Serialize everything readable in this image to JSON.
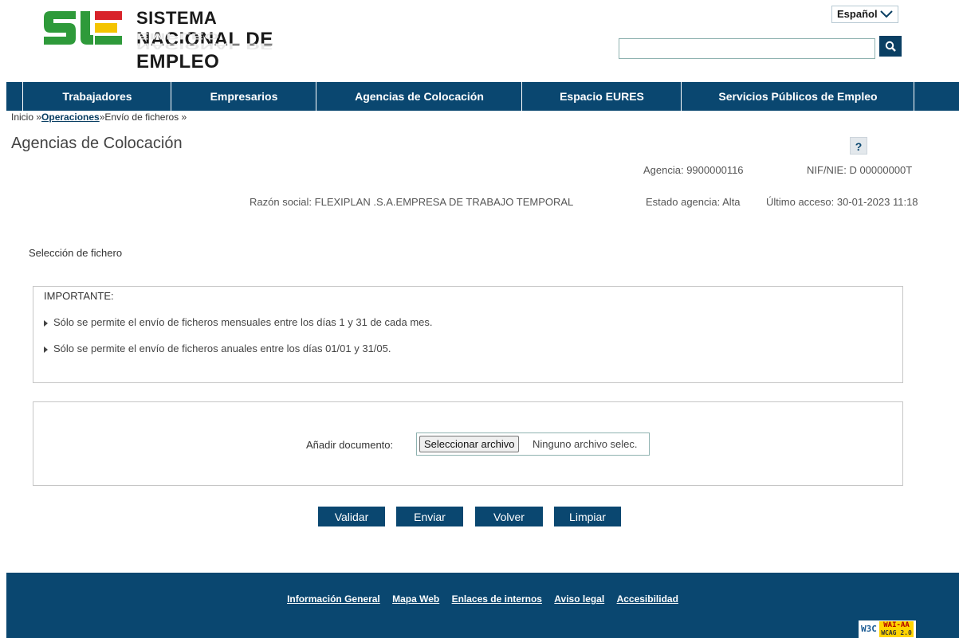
{
  "header": {
    "logo_line1": "SISTEMA",
    "logo_line2": "NACIONAL DE EMPLEO",
    "language": "Español",
    "search_placeholder": ""
  },
  "nav": {
    "items": [
      {
        "label": "Trabajadores"
      },
      {
        "label": "Empresarios"
      },
      {
        "label": "Agencias de Colocación"
      },
      {
        "label": "Espacio EURES"
      },
      {
        "label": "Servicios Públicos de Empleo"
      }
    ]
  },
  "breadcrumb": {
    "home": "Inicio »",
    "operations": "Operaciones",
    "current": "»Envío de ficheros »"
  },
  "page": {
    "title": "Agencias de Colocación",
    "help": "?"
  },
  "agency": {
    "agencia": "Agencia: 9900000116",
    "nif": "NIF/NIE: D 00000000T",
    "razon_social": "Razón social: FLEXIPLAN .S.A.EMPRESA DE TRABAJO TEMPORAL",
    "estado": "Estado agencia: Alta",
    "ultimo_acceso": "Último acceso: 30-01-2023 11:18"
  },
  "selection": {
    "label": "Selección de fichero"
  },
  "important": {
    "title": "IMPORTANTE:",
    "items": [
      "Sólo se permite el envío de ficheros mensuales entre los días 1 y 31 de cada mes.",
      "Sólo se permite el envío de ficheros anuales entre los días 01/01 y 31/05."
    ]
  },
  "upload": {
    "label": "Añadir documento:",
    "button": "Seleccionar archivo",
    "status": "Ninguno archivo selec."
  },
  "actions": {
    "validar": "Validar",
    "enviar": "Enviar",
    "volver": "Volver",
    "limpiar": "Limpiar"
  },
  "footer": {
    "links": [
      "Información General",
      "Mapa Web",
      "Enlaces de internos",
      "Aviso legal",
      "Accesibilidad"
    ],
    "badge_w3c": "W3C",
    "badge_wai": "WAI-AA",
    "badge_wcag": "WCAG 2.0"
  },
  "colors": {
    "primary": "#0a4770",
    "logo_green": "#2e9a3a",
    "logo_red": "#d8232a",
    "logo_yellow": "#f4c400"
  }
}
